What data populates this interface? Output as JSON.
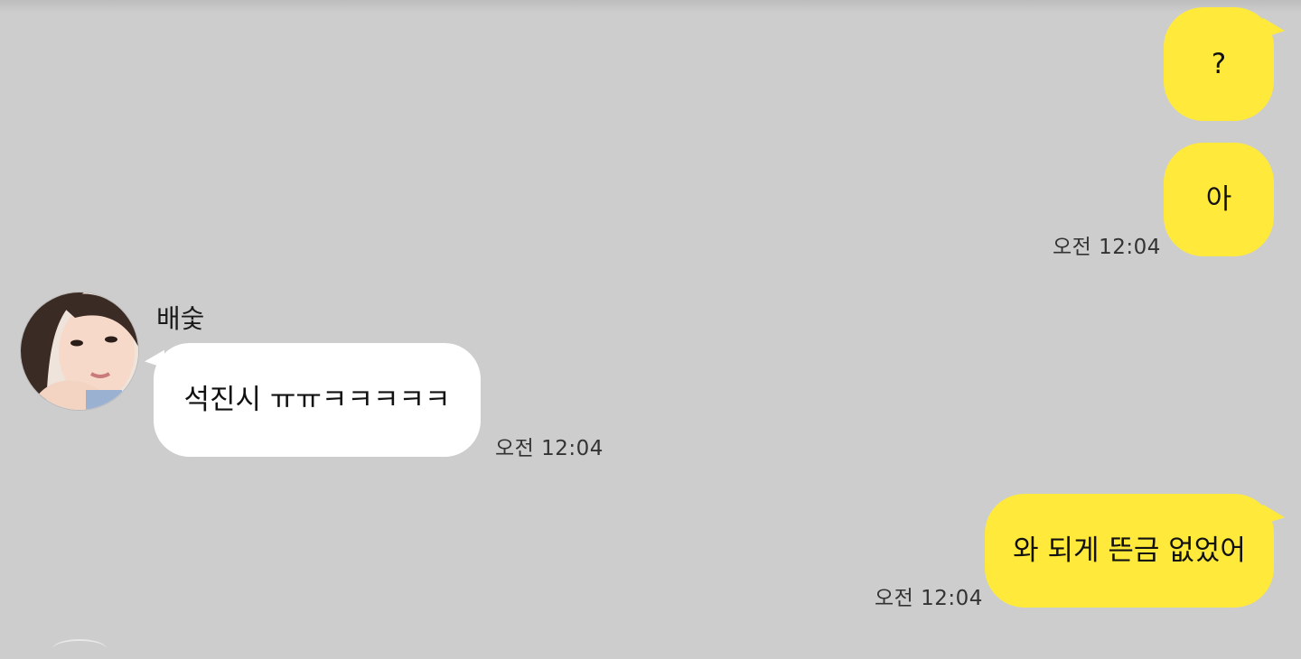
{
  "colors": {
    "background": "#cdcdcd",
    "my_bubble": "#ffe93b",
    "their_bubble": "#ffffff"
  },
  "messages": [
    {
      "side": "me",
      "text": "?"
    },
    {
      "side": "me",
      "text": "아",
      "time": "오전 12:04"
    },
    {
      "side": "them",
      "sender": "배숯",
      "text": "석진시 ㅠㅠㅋㅋㅋㅋㅋ",
      "time": "오전 12:04"
    },
    {
      "side": "me",
      "text": "와 되게 뜬금 없었어",
      "time": "오전 12:04"
    }
  ],
  "icons": {
    "avatar": "profile-photo-avatar"
  }
}
